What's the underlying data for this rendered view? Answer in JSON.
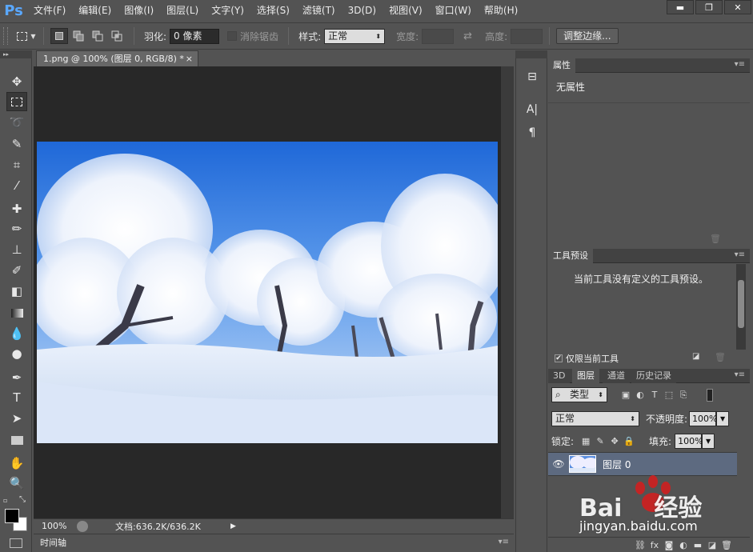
{
  "app": {
    "logo": "Ps"
  },
  "menu": [
    "文件(F)",
    "编辑(E)",
    "图像(I)",
    "图层(L)",
    "文字(Y)",
    "选择(S)",
    "滤镜(T)",
    "3D(D)",
    "视图(V)",
    "窗口(W)",
    "帮助(H)"
  ],
  "window_controls": {
    "minimize": "▬",
    "maximize": "❐",
    "close": "✕"
  },
  "options": {
    "feather_label": "羽化:",
    "feather_value": "0 像素",
    "antialias_label": "消除锯齿",
    "style_label": "样式:",
    "style_value": "正常",
    "width_label": "宽度:",
    "height_label": "高度:",
    "refine_button": "调整边缘..."
  },
  "document": {
    "tab_title": "1.png @ 100% (图层 0, RGB/8) *",
    "tab_close": "×",
    "zoom": "100%",
    "doc_size": "文档:636.2K/636.2K",
    "status_arrow": "▶"
  },
  "timeline": {
    "label": "时间轴"
  },
  "panels": {
    "properties": {
      "tab": "属性",
      "content": "无属性"
    },
    "tool_presets": {
      "tab": "工具预设",
      "content": "当前工具没有定义的工具预设。",
      "current_tool_only": "仅限当前工具"
    },
    "layers": {
      "tabs": [
        "3D",
        "图层",
        "通道",
        "历史记录"
      ],
      "active_tab": "图层",
      "filter_label": "类型",
      "blend_mode": "正常",
      "opacity_label": "不透明度:",
      "opacity_value": "100%",
      "lock_label": "锁定:",
      "fill_label": "填充:",
      "fill_value": "100%",
      "layer_name": "图层 0"
    }
  },
  "watermark": {
    "brand": "Bai",
    "brand2": "经验",
    "url": "jingyan.baidu.com"
  },
  "colors": {
    "ui_bg": "#535353",
    "canvas_bg": "#282828",
    "panel_header": "#424242",
    "layer_selected": "#5d6a80",
    "accent_logo": "#5aa8ff",
    "watermark_red": "#d02020"
  }
}
